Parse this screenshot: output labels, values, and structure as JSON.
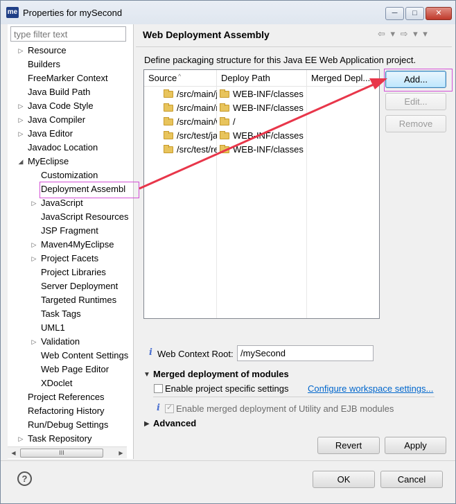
{
  "window": {
    "title": "Properties for mySecond",
    "app_logo": "me",
    "min_symbol": "─",
    "max_symbol": "□",
    "close_symbol": "✕"
  },
  "filter": {
    "placeholder": "type filter text"
  },
  "tree": {
    "items": [
      {
        "label": "Resource"
      },
      {
        "label": "Builders"
      },
      {
        "label": "FreeMarker Context"
      },
      {
        "label": "Java Build Path"
      },
      {
        "label": "Java Code Style"
      },
      {
        "label": "Java Compiler"
      },
      {
        "label": "Java Editor"
      },
      {
        "label": "Javadoc Location"
      },
      {
        "label": "MyEclipse"
      },
      {
        "label": "Customization"
      },
      {
        "label": "Deployment Assembl"
      },
      {
        "label": "JavaScript"
      },
      {
        "label": "JavaScript Resources"
      },
      {
        "label": "JSP Fragment"
      },
      {
        "label": "Maven4MyEclipse"
      },
      {
        "label": "Project Facets"
      },
      {
        "label": "Project Libraries"
      },
      {
        "label": "Server Deployment"
      },
      {
        "label": "Targeted Runtimes"
      },
      {
        "label": "Task Tags"
      },
      {
        "label": "UML1"
      },
      {
        "label": "Validation"
      },
      {
        "label": "Web Content Settings"
      },
      {
        "label": "Web Page Editor"
      },
      {
        "label": "XDoclet"
      },
      {
        "label": "Project References"
      },
      {
        "label": "Refactoring History"
      },
      {
        "label": "Run/Debug Settings"
      },
      {
        "label": "Task Repository"
      }
    ],
    "scroll_left": "◀",
    "scroll_right": "▶",
    "scroll_grip": "III"
  },
  "page": {
    "title": "Web Deployment Assembly",
    "nav": "⇦ ▾ ⇨ ▾ ▾",
    "description": "Define packaging structure for this Java EE Web Application project."
  },
  "table": {
    "columns": [
      "Source",
      "Deploy Path",
      "Merged Depl..."
    ],
    "rows": [
      {
        "source": "/src/main/java",
        "deploy": "WEB-INF/classes",
        "merged": ""
      },
      {
        "source": "/src/main/resources",
        "deploy": "WEB-INF/classes",
        "merged": ""
      },
      {
        "source": "/src/main/webapp",
        "deploy": "/",
        "merged": ""
      },
      {
        "source": "/src/test/java",
        "deploy": "WEB-INF/classes",
        "merged": ""
      },
      {
        "source": "/src/test/resources",
        "deploy": "WEB-INF/classes",
        "merged": ""
      }
    ]
  },
  "buttons": {
    "add": "Add...",
    "edit": "Edit...",
    "remove": "Remove",
    "revert": "Revert",
    "apply": "Apply",
    "ok": "OK",
    "cancel": "Cancel"
  },
  "context_root": {
    "label": "Web Context Root:",
    "value": "/mySecond",
    "info": "i"
  },
  "merged_section": {
    "title": "Merged deployment of modules",
    "toggle": "▼",
    "project_specific_label": "Enable project specific settings",
    "configure_link": "Configure workspace settings...",
    "enable_merged_label": "Enable merged deployment of Utility and EJB modules",
    "info": "i"
  },
  "advanced_section": {
    "title": "Advanced",
    "toggle": "▶"
  },
  "help": {
    "symbol": "?"
  },
  "colors": {
    "annotation": "#e8364a",
    "highlight": "#d34fd6",
    "link": "#0066cc"
  }
}
